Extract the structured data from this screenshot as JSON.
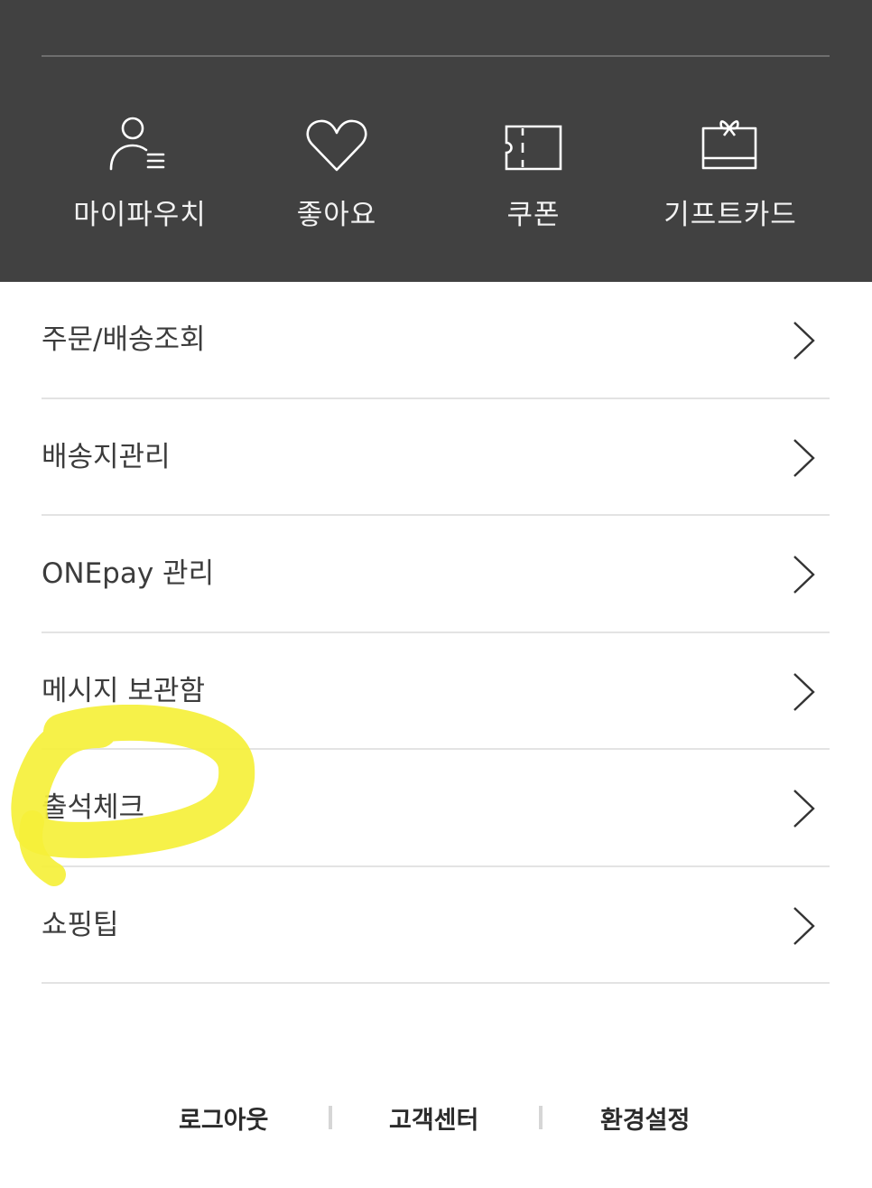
{
  "quick_menu": [
    {
      "label": "마이파우치",
      "icon": "user-list-icon"
    },
    {
      "label": "좋아요",
      "icon": "heart-icon"
    },
    {
      "label": "쿠폰",
      "icon": "coupon-icon"
    },
    {
      "label": "기프트카드",
      "icon": "gift-card-icon"
    }
  ],
  "menu": [
    {
      "label": "주문/배송조회"
    },
    {
      "label": "배송지관리"
    },
    {
      "label": "ONEpay 관리"
    },
    {
      "label": "메시지 보관함"
    },
    {
      "label": "출석체크"
    },
    {
      "label": "쇼핑팁"
    }
  ],
  "footer": {
    "logout": "로그아웃",
    "customer_center": "고객센터",
    "settings": "환경설정"
  },
  "colors": {
    "header_bg": "#414141",
    "highlight": "#f5f03a"
  }
}
